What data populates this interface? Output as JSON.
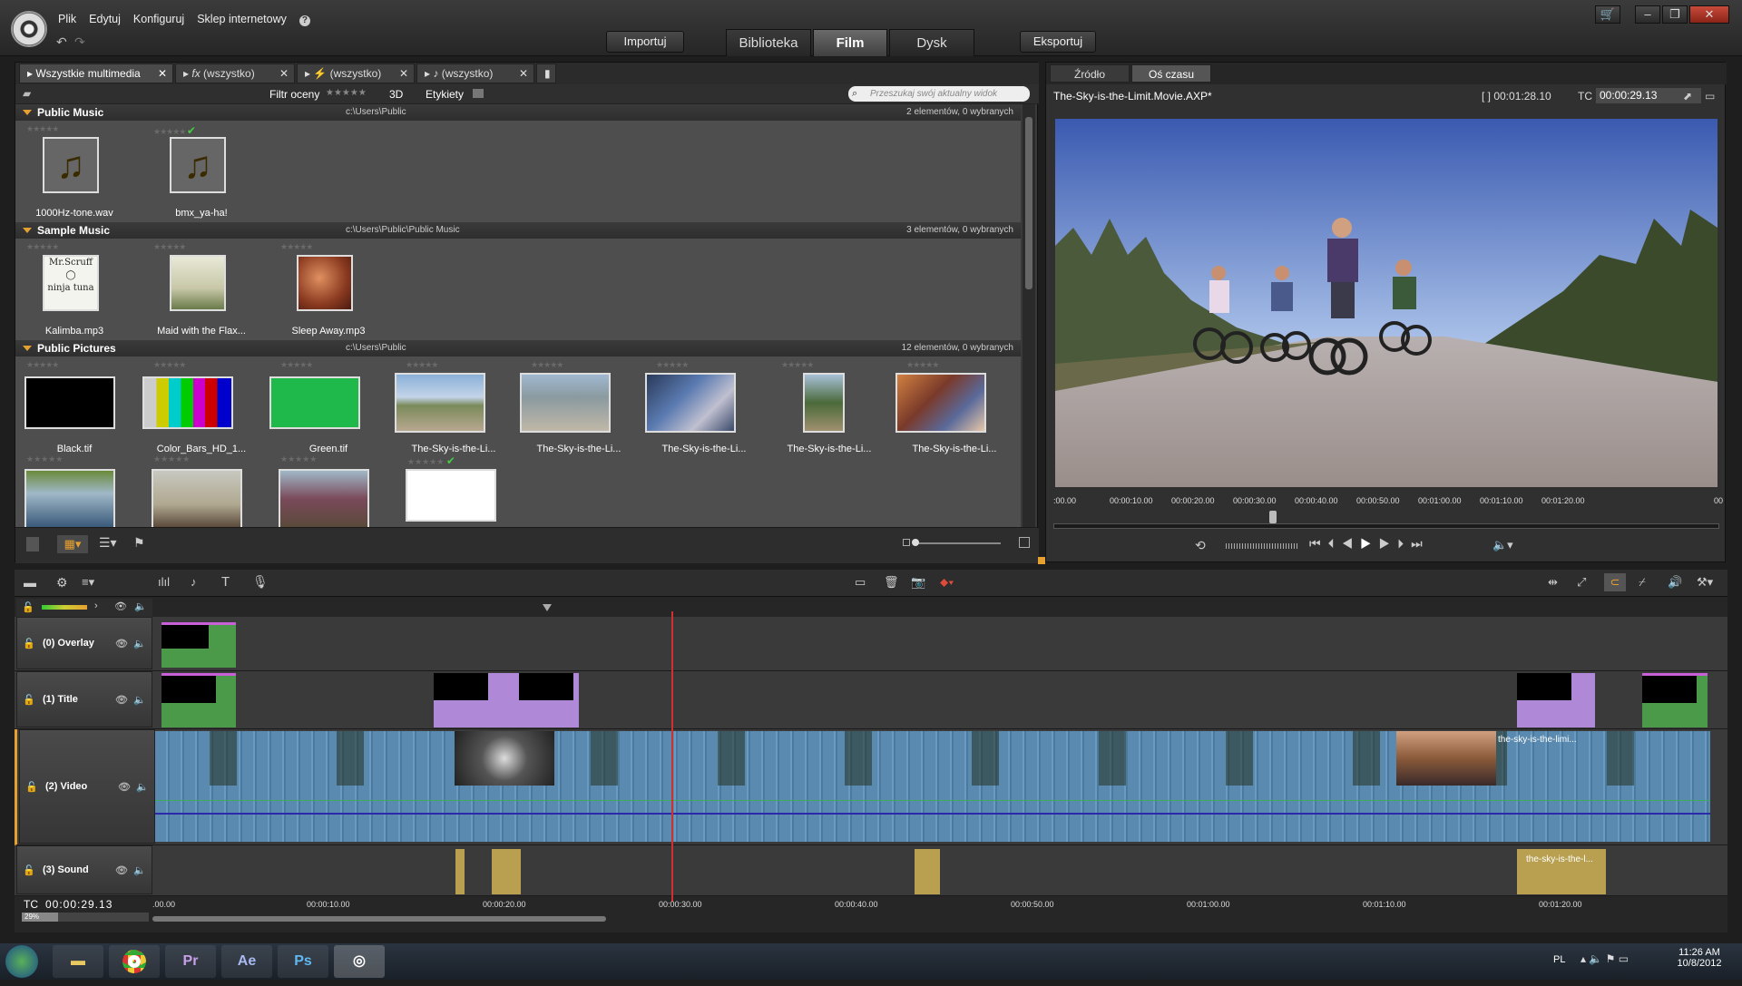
{
  "menu": {
    "items": [
      "Plik",
      "Edytuj",
      "Konfiguruj",
      "Sklep internetowy"
    ]
  },
  "header": {
    "import_label": "Importuj",
    "export_label": "Eksportuj",
    "tabs": [
      "Biblioteka",
      "Film",
      "Dysk"
    ],
    "active_tab": "Film"
  },
  "library": {
    "tabs": [
      "Wszystkie multimedia",
      "(wszystko)",
      "(wszystko)",
      "(wszystko)"
    ],
    "filter_label": "Filtr oceny",
    "threed_label": "3D",
    "tags_label": "Etykiety",
    "search_placeholder": "Przeszukaj swój aktualny widok",
    "groups": [
      {
        "name": "Public Music",
        "path": "c:\\Users\\Public",
        "count": "2 elementów, 0 wybranych",
        "items": [
          "1000Hz-tone.wav",
          "bmx_ya-ha!"
        ]
      },
      {
        "name": "Sample Music",
        "path": "c:\\Users\\Public\\Public Music",
        "count": "3 elementów, 0 wybranych",
        "items": [
          "Kalimba.mp3",
          "Maid with the Flax...",
          "Sleep Away.mp3"
        ]
      },
      {
        "name": "Public Pictures",
        "path": "c:\\Users\\Public",
        "count": "12 elementów, 0 wybranych",
        "items": [
          "Black.tif",
          "Color_Bars_HD_1...",
          "Green.tif",
          "The-Sky-is-the-Li...",
          "The-Sky-is-the-Li...",
          "The-Sky-is-the-Li...",
          "The-Sky-is-the-Li...",
          "The-Sky-is-the-Li..."
        ]
      }
    ]
  },
  "preview": {
    "tabs": [
      "Źródło",
      "Oś czasu"
    ],
    "active_tab": "Oś czasu",
    "file": "The-Sky-is-the-Limit.Movie.AXP*",
    "duration": "[ ] 00:01:28.10",
    "tc_label": "TC",
    "tc": "00:00:29.13",
    "ruler": [
      ":00.00",
      "00:00:10.00",
      "00:00:20.00",
      "00:00:30.00",
      "00:00:40.00",
      "00:00:50.00",
      "00:01:00.00",
      "00:01:10.00",
      "00:01:20.00",
      "00"
    ]
  },
  "timeline": {
    "tracks": [
      "(0) Overlay",
      "(1) Title",
      "(2) Video",
      "(3) Sound"
    ],
    "clip_labels": {
      "video_end": "the-sky-is-the-limi...",
      "sound_end": "the-sky-is-the-l..."
    },
    "tc_label": "TC",
    "tc": "00:00:29.13",
    "zoom": "29%",
    "ruler": [
      ".00.00",
      "00:00:10.00",
      "00:00:20.00",
      "00:00:30.00",
      "00:00:40.00",
      "00:00:50.00",
      "00:01:00.00",
      "00:01:10.00",
      "00:01:20.00"
    ]
  },
  "taskbar": {
    "apps": [
      "Pr",
      "Ae",
      "Ps"
    ],
    "lang": "PL",
    "time": "11:26 AM",
    "date": "10/8/2012"
  },
  "colors": {
    "accent": "#e6a030",
    "purple": "#c860d8",
    "green": "#3fae5a",
    "clip_blue": "#6a9ac0"
  }
}
